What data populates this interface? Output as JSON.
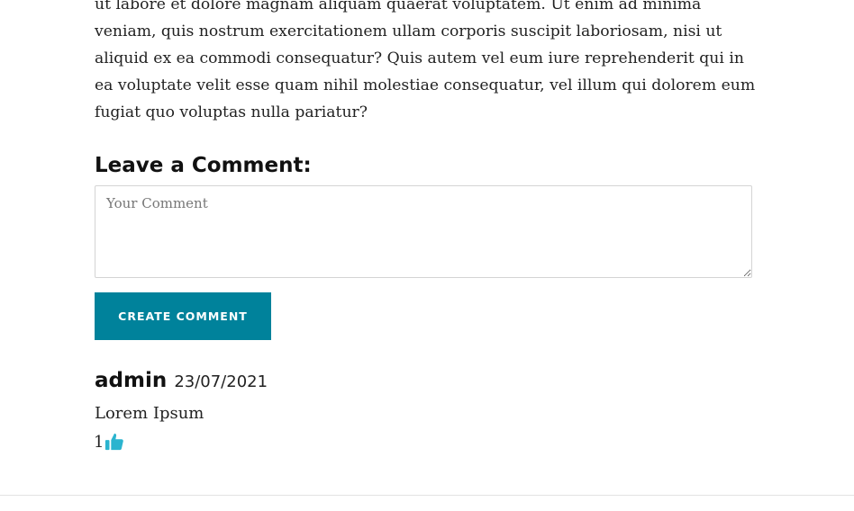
{
  "article": {
    "paragraph": "ut labore et dolore magnam aliquam quaerat voluptatem. Ut enim ad minima veniam, quis nostrum exercitationem ullam corporis suscipit laboriosam, nisi ut aliquid ex ea commodi consequatur? Quis autem vel eum iure reprehenderit qui in ea voluptate velit esse quam nihil molestiae consequatur, vel illum qui dolorem eum fugiat quo voluptas nulla pariatur?"
  },
  "comment_form": {
    "heading": "Leave a Comment:",
    "textarea_placeholder": "Your Comment",
    "textarea_value": "",
    "submit_label": "CREATE COMMENT"
  },
  "comments": [
    {
      "author": "admin",
      "date": "23/07/2021",
      "body": "Lorem Ipsum",
      "likes": "1",
      "like_icon": "thumbs-up-icon"
    }
  ],
  "colors": {
    "accent": "#00829b",
    "like_icon": "#2bb4cf",
    "text": "#222222",
    "border": "#d4d4d4"
  }
}
